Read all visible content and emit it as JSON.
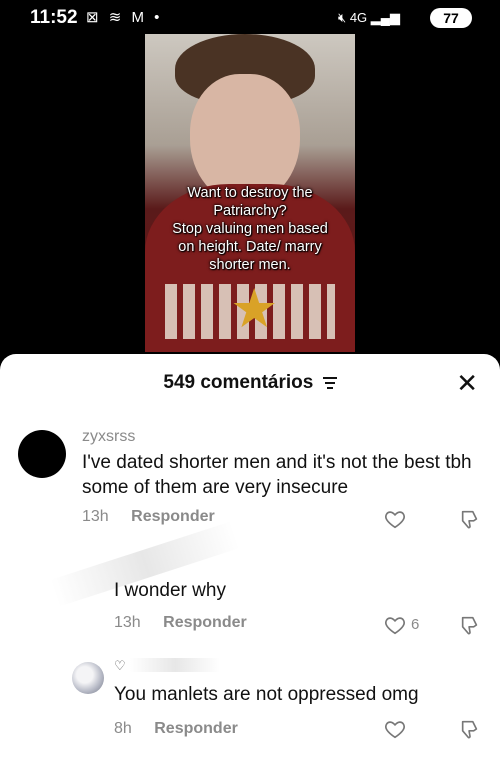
{
  "status_bar": {
    "time": "11:52",
    "left_icons": [
      "xbox-icon",
      "wifi-icon",
      "gmail-icon",
      "dot-icon"
    ],
    "right_icons": [
      "mute-icon",
      "4g-icon",
      "signal-icon"
    ],
    "battery": "77"
  },
  "video": {
    "overlay_lines": [
      "Want to destroy the",
      "Patriarchy?",
      "Stop valuing men based",
      "on height. Date/ marry",
      "shorter men."
    ]
  },
  "comments_panel": {
    "title": "549 comentários",
    "close_label": "✕"
  },
  "comments": [
    {
      "username": "zyxsrss",
      "text": "I've dated shorter men and it's not the best tbh some of them are very insecure",
      "time": "13h",
      "reply_label": "Responder",
      "likes": ""
    },
    {
      "username": "",
      "text": "I wonder why",
      "time": "13h",
      "reply_label": "Responder",
      "likes": "6"
    },
    {
      "username": "",
      "text": "You manlets are not oppressed omg",
      "time": "8h",
      "reply_label": "Responder",
      "likes": ""
    }
  ]
}
